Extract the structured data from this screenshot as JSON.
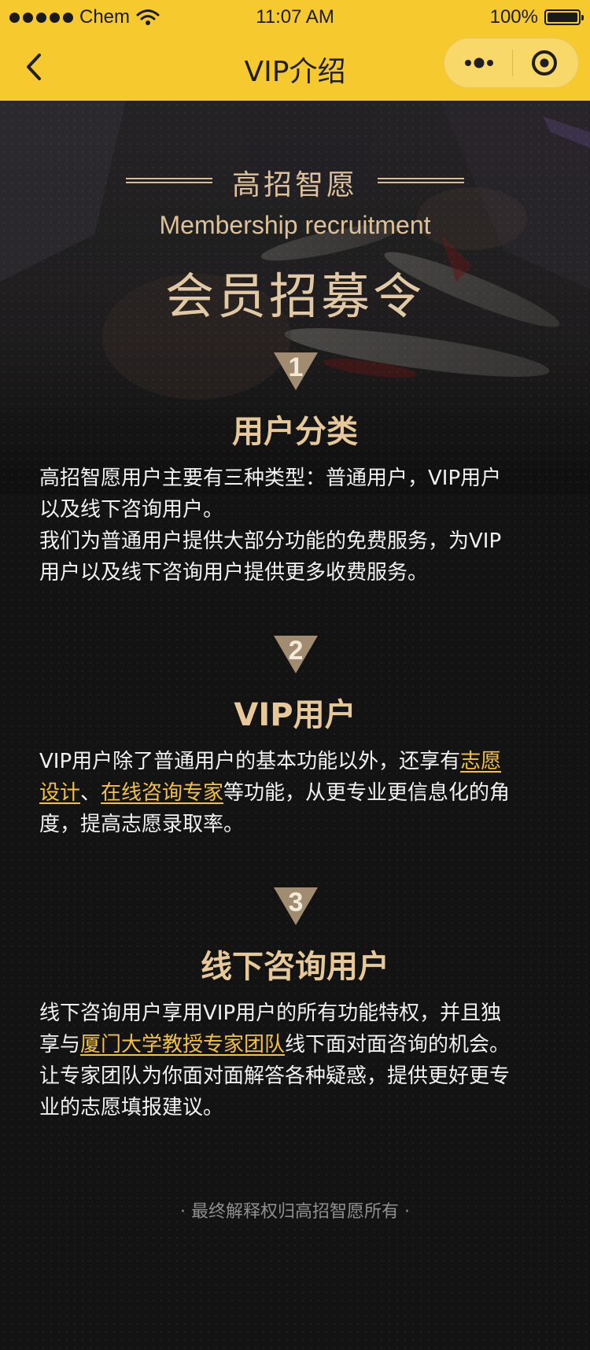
{
  "status_bar": {
    "carrier": "Chem",
    "time": "11:07 AM",
    "battery": "100%"
  },
  "nav": {
    "title": "VIP介绍"
  },
  "hero": {
    "brand": "高招智愿",
    "subtitle_en": "Membership recruitment",
    "headline": "会员招募令"
  },
  "sections": [
    {
      "number": "1",
      "title": "用户分类",
      "lines": [
        [
          {
            "text": "高招智愿用户主要有三种类型：普通用户，VIP用户"
          }
        ],
        [
          {
            "text": "以及线下咨询用户。"
          }
        ],
        [
          {
            "text": "我们为普通用户提供大部分功能的免费服务，为VIP"
          }
        ],
        [
          {
            "text": "用户以及线下咨询用户提供更多收费服务。"
          }
        ]
      ]
    },
    {
      "number": "2",
      "title": "VIP用户",
      "lines": [
        [
          {
            "text": "VIP用户除了普通用户的基本功能以外，还享有"
          },
          {
            "text": "志愿",
            "link": true
          }
        ],
        [
          {
            "text": "设计",
            "link": true
          },
          {
            "text": "、"
          },
          {
            "text": "在线咨询专家",
            "link": true
          },
          {
            "text": "等功能，从更专业更信息化的角"
          }
        ],
        [
          {
            "text": "度，提高志愿录取率。"
          }
        ]
      ]
    },
    {
      "number": "3",
      "title": "线下咨询用户",
      "lines": [
        [
          {
            "text": "线下咨询用户享用VIP用户的所有功能特权，并且独"
          }
        ],
        [
          {
            "text": "享与"
          },
          {
            "text": "厦门大学教授专家团队",
            "link": true
          },
          {
            "text": "线下面对面咨询的机会。"
          }
        ],
        [
          {
            "text": "让专家团队为你面对面解答各种疑惑，提供更好更专"
          }
        ],
        [
          {
            "text": "业的志愿填报建议。"
          }
        ]
      ]
    }
  ],
  "footer": {
    "text": "· 最终解释权归高招智愿所有 ·"
  },
  "colors": {
    "accent": "#f6c92e",
    "gold": "#e6c899",
    "link": "#f3c23e",
    "background": "#131313"
  }
}
